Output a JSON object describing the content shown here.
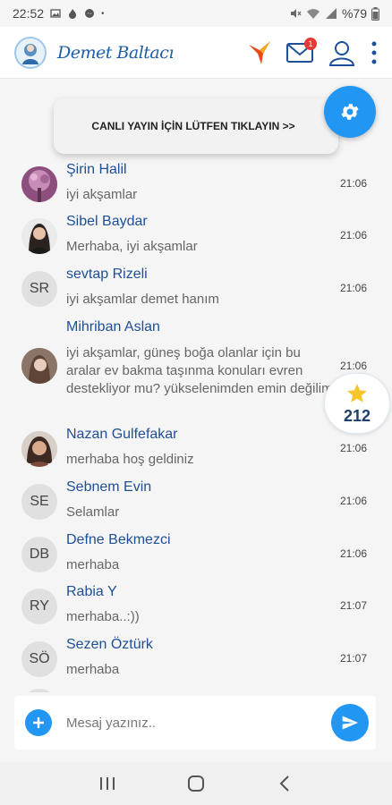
{
  "status_bar": {
    "time": "22:52",
    "battery": "%79"
  },
  "header": {
    "brand": "Demet Baltacı",
    "mail_badge": "1",
    "icons": [
      "logo-icon",
      "bird-logo-icon",
      "mail-icon",
      "profile-icon",
      "more-vert-icon"
    ]
  },
  "banner": {
    "text": "CANLI YAYIN İÇİN LÜTFEN TIKLAYIN >>"
  },
  "messages": [
    {
      "name": "Şirin Halil",
      "text": "iyi akşamlar",
      "time": "21:06",
      "avatar": "photo",
      "initials": ""
    },
    {
      "name": "Sibel Baydar",
      "text": "Merhaba, iyi akşamlar",
      "time": "21:06",
      "avatar": "photo",
      "initials": ""
    },
    {
      "name": "sevtap Rizeli",
      "text": "iyi akşamlar demet hanım",
      "time": "21:06",
      "avatar": "initials",
      "initials": "SR"
    },
    {
      "name": "Mihriban Aslan",
      "text": "iyi akşamlar, güneş boğa olanlar için bu aralar ev bakma taşınma konuları evren destekliyor mu? yükselenimden emin değilim",
      "time": "21:06",
      "avatar": "photo",
      "initials": ""
    },
    {
      "name": "Nazan Gulfefakar",
      "text": "merhaba hoş geldiniz",
      "time": "21:06",
      "avatar": "photo",
      "initials": ""
    },
    {
      "name": "Sebnem Evin",
      "text": "Selamlar",
      "time": "21:06",
      "avatar": "initials",
      "initials": "SE"
    },
    {
      "name": "Defne Bekmezci",
      "text": "merhaba",
      "time": "21:06",
      "avatar": "initials",
      "initials": "DB"
    },
    {
      "name": "Rabia Y",
      "text": "merhaba..:))",
      "time": "21:07",
      "avatar": "initials",
      "initials": "RY"
    },
    {
      "name": "Sezen Öztürk",
      "text": "merhaba",
      "time": "21:07",
      "avatar": "initials",
      "initials": "SÖ"
    }
  ],
  "star_badge": {
    "count": "212"
  },
  "composer": {
    "placeholder": "Mesaj yazınız.."
  },
  "colors": {
    "accent": "#2196f3",
    "name": "#1e4f97",
    "brand": "#1e5ea8"
  }
}
